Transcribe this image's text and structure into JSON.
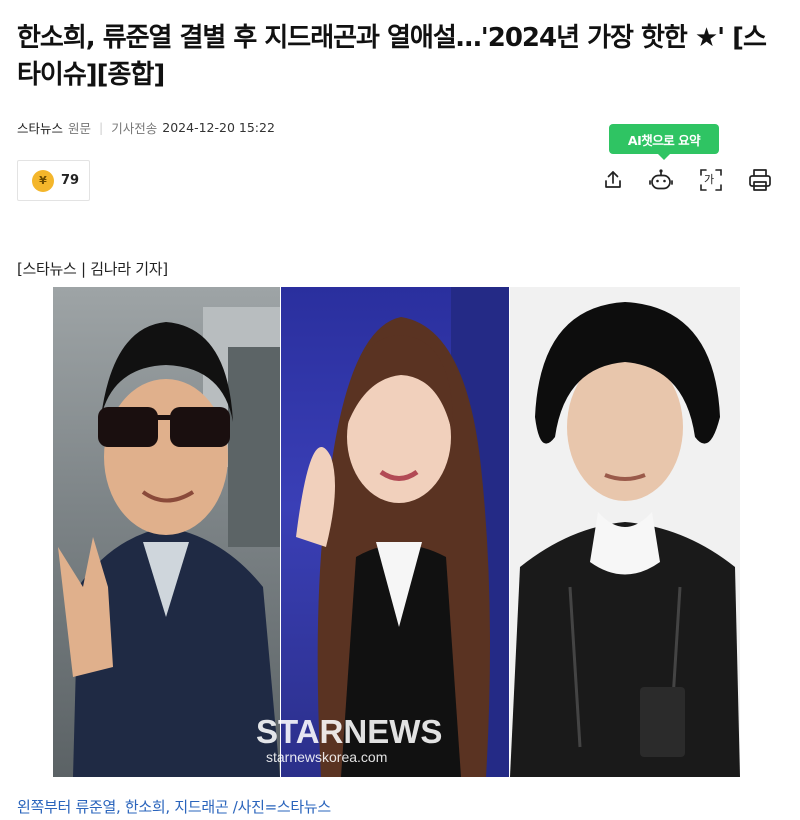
{
  "article": {
    "headline": "한소희, 류준열 결별 후 지드래곤과 열애설…'2024년 가장 핫한 ★' [스타이슈][종합]",
    "press": "스타뉴스",
    "original_label": "원문",
    "date_label": "기사전송",
    "date": "2024-12-20 15:22",
    "byline": "[스타뉴스 | 김나라 기자]",
    "caption": "왼쪽부터 류준열, 한소희, 지드래곤 /사진=스타뉴스"
  },
  "reaction": {
    "coin_symbol": "¥",
    "count": "79"
  },
  "tools": {
    "ai_tooltip": "AI챗으로 요약",
    "icons": [
      "share-icon",
      "ai-chat-bot-icon",
      "text-size-icon",
      "print-icon"
    ],
    "text_size_glyph": "가"
  },
  "photo": {
    "watermark": "STARNEWS",
    "watermark_url": "starnewskorea.com",
    "colors": {
      "left_bg": "#7d8487",
      "center_bg": "#3a3fb6",
      "right_bg": "#f1f1f1"
    }
  }
}
